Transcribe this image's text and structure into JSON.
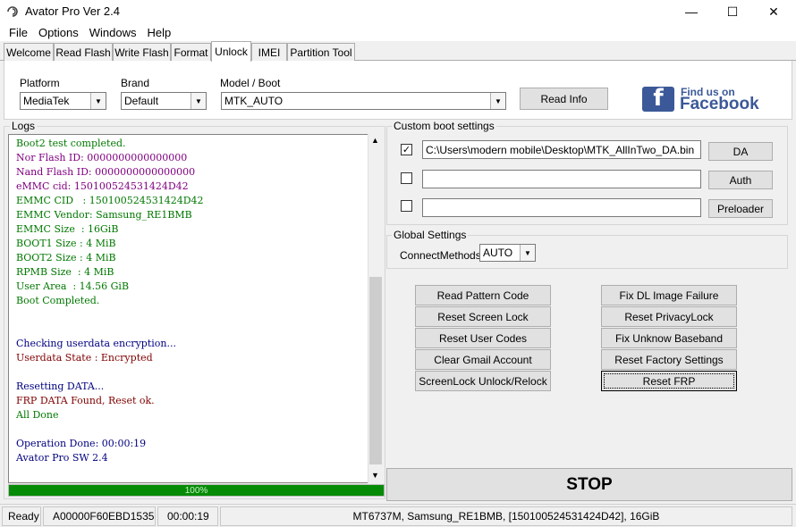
{
  "window": {
    "title": "Avator Pro  Ver 2.4",
    "minimize": "—",
    "maximize": "☐",
    "close": "✕"
  },
  "menu": [
    "File",
    "Options",
    "Windows",
    "Help"
  ],
  "tabs": [
    "Welcome",
    "Read Flash",
    "Write Flash",
    "Format",
    "Unlock",
    "IMEI",
    "Partition Tool"
  ],
  "active_tab": "Unlock",
  "top": {
    "platform_label": "Platform",
    "platform_value": "MediaTek",
    "brand_label": "Brand",
    "brand_value": "Default",
    "model_label": "Model / Boot",
    "model_value": "MTK_AUTO",
    "read_info": "Read Info",
    "facebook_top": "Find us on",
    "facebook_bottom": "Facebook",
    "facebook_icon": "f"
  },
  "logs": {
    "title": "Logs",
    "lines": [
      {
        "text": "Boot2 test completed.",
        "color": "green"
      },
      {
        "text": "Nor Flash ID: 0000000000000000",
        "color": "purple"
      },
      {
        "text": "Nand Flash ID: 0000000000000000",
        "color": "purple"
      },
      {
        "text": "eMMC cid: 150100524531424D42",
        "color": "purple"
      },
      {
        "text": "EMMC CID   : 150100524531424D42",
        "color": "green"
      },
      {
        "text": "EMMC Vendor: Samsung_RE1BMB",
        "color": "green"
      },
      {
        "text": "EMMC Size  : 16GiB",
        "color": "green"
      },
      {
        "text": "BOOT1 Size : 4 MiB",
        "color": "green"
      },
      {
        "text": "BOOT2 Size : 4 MiB",
        "color": "green"
      },
      {
        "text": "RPMB Size  : 4 MiB",
        "color": "green"
      },
      {
        "text": "User Area  : 14.56 GiB",
        "color": "green"
      },
      {
        "text": "Boot Completed.",
        "color": "green"
      },
      {
        "text": "",
        "color": "navy"
      },
      {
        "text": "",
        "color": "navy"
      },
      {
        "text": "Checking userdata encryption...",
        "color": "navy"
      },
      {
        "text": "Userdata State : Encrypted",
        "color": "red"
      },
      {
        "text": "",
        "color": "navy"
      },
      {
        "text": "Resetting DATA...",
        "color": "navy"
      },
      {
        "text": "FRP DATA Found, Reset ok.",
        "color": "red"
      },
      {
        "text": "All Done",
        "color": "green"
      },
      {
        "text": "",
        "color": "navy"
      },
      {
        "text": "Operation Done: 00:00:19",
        "color": "navy"
      },
      {
        "text": "Avator Pro SW 2.4",
        "color": "navy"
      }
    ],
    "progress_text": "100%",
    "progress_fraction": 1.0,
    "scroll_up": "▲",
    "scroll_down": "▼"
  },
  "custom_boot": {
    "title": "Custom boot settings",
    "rows": [
      {
        "checked": true,
        "check_mark": "✓",
        "value": "C:\\Users\\modern mobile\\Desktop\\MTK_AllInTwo_DA.bin",
        "button": "DA"
      },
      {
        "checked": false,
        "check_mark": "",
        "value": "",
        "button": "Auth"
      },
      {
        "checked": false,
        "check_mark": "",
        "value": "",
        "button": "Preloader"
      }
    ]
  },
  "global": {
    "title": "Global Settings",
    "connect_label": "ConnectMethods",
    "connect_value": "AUTO"
  },
  "actions_left": [
    "Read Pattern Code",
    "Reset Screen Lock",
    "Reset User Codes",
    "Clear Gmail Account",
    "ScreenLock Unlock/Relock"
  ],
  "actions_right": [
    "Fix DL Image Failure",
    "Reset PrivacyLock",
    "Fix Unknow Baseband",
    "Reset Factory Settings",
    "Reset FRP"
  ],
  "stop": "STOP",
  "status": {
    "state": "Ready",
    "id": "A00000F60EBD1535",
    "time": "00:00:19",
    "device": "MT6737M, Samsung_RE1BMB,  [150100524531424D42],  16GiB"
  },
  "colors": {
    "accent_green": "#068b06",
    "facebook_blue": "#3b5998"
  }
}
